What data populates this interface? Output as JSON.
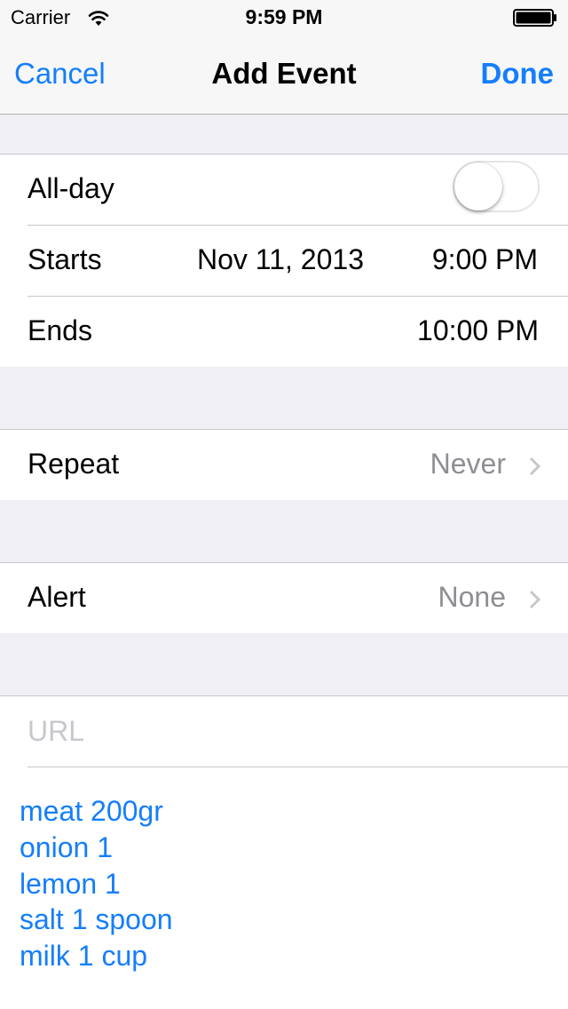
{
  "status_bar": {
    "carrier": "Carrier",
    "time": "9:59 PM"
  },
  "nav": {
    "cancel_label": "Cancel",
    "title": "Add Event",
    "done_label": "Done"
  },
  "rows": {
    "all_day": {
      "label": "All-day",
      "toggle_on": false
    },
    "starts": {
      "label": "Starts",
      "date": "Nov 11, 2013",
      "time": "9:00 PM"
    },
    "ends": {
      "label": "Ends",
      "time": "10:00 PM"
    },
    "repeat": {
      "label": "Repeat",
      "value": "Never"
    },
    "alert": {
      "label": "Alert",
      "value": "None"
    }
  },
  "url": {
    "placeholder": "URL"
  },
  "notes": [
    "meat 200gr",
    "onion 1",
    "lemon 1",
    "salt 1 spoon",
    "milk 1 cup"
  ],
  "colors": {
    "accent": "#157efb",
    "group_bg": "#efeff4",
    "separator": "#c8c7cc",
    "secondary_text": "#8e8e93"
  }
}
